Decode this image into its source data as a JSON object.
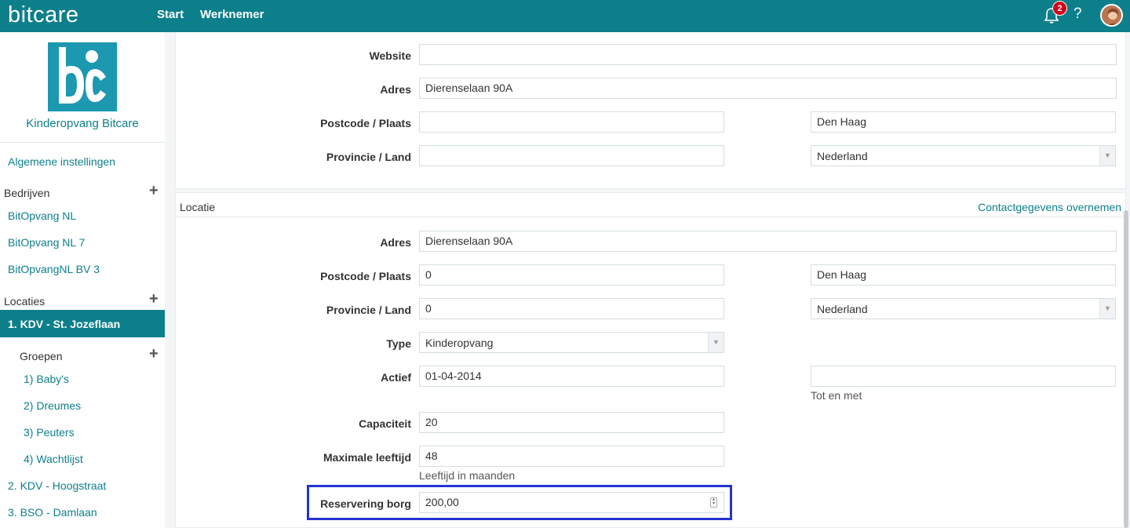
{
  "topbar": {
    "brand": "bitcare",
    "nav": [
      "Start",
      "Werknemer"
    ],
    "notification_count": "2",
    "help_label": "?"
  },
  "sidebar": {
    "company_name": "Kinderopvang Bitcare",
    "general_settings": "Algemene instellingen",
    "companies_heading": "Bedrijven",
    "companies": [
      "BitOpvang NL",
      "BitOpvang NL 7",
      "BitOpvangNL BV 3"
    ],
    "locations_heading": "Locaties",
    "active_location": "1. KDV - St. Jozeflaan",
    "groups_heading": "Groepen",
    "groups": [
      "1) Baby's",
      "2) Dreumes",
      "3) Peuters",
      "4) Wachtlijst"
    ],
    "other_locations": [
      "2. KDV - Hoogstraat",
      "3. BSO - Damlaan"
    ]
  },
  "company_contact": {
    "website_label": "Website",
    "website_value": "",
    "address_label": "Adres",
    "address_value": "Dierenselaan 90A",
    "postcode_label": "Postcode / Plaats",
    "postcode_value": "",
    "city_value": "Den Haag",
    "province_label": "Provincie / Land",
    "province_value": "",
    "country_value": "Nederland"
  },
  "location": {
    "title": "Locatie",
    "copy_contact_link": "Contactgegevens overnemen",
    "address_label": "Adres",
    "address_value": "Dierenselaan 90A",
    "postcode_label": "Postcode / Plaats",
    "postcode_value": "0",
    "city_value": "Den Haag",
    "province_label": "Provincie / Land",
    "province_value": "0",
    "country_value": "Nederland",
    "type_label": "Type",
    "type_value": "Kinderopvang",
    "active_label": "Actief",
    "active_from": "01-04-2014",
    "active_to": "",
    "active_to_hint": "Tot en met",
    "capacity_label": "Capaciteit",
    "capacity_value": "20",
    "max_age_label": "Maximale leeftijd",
    "max_age_value": "48",
    "max_age_hint": "Leeftijd in maanden",
    "deposit_label": "Reservering borg",
    "deposit_value": "200,00"
  },
  "colors": {
    "primary": "#0d7f8b",
    "badge": "#d0021b",
    "highlight": "#2432d3"
  }
}
